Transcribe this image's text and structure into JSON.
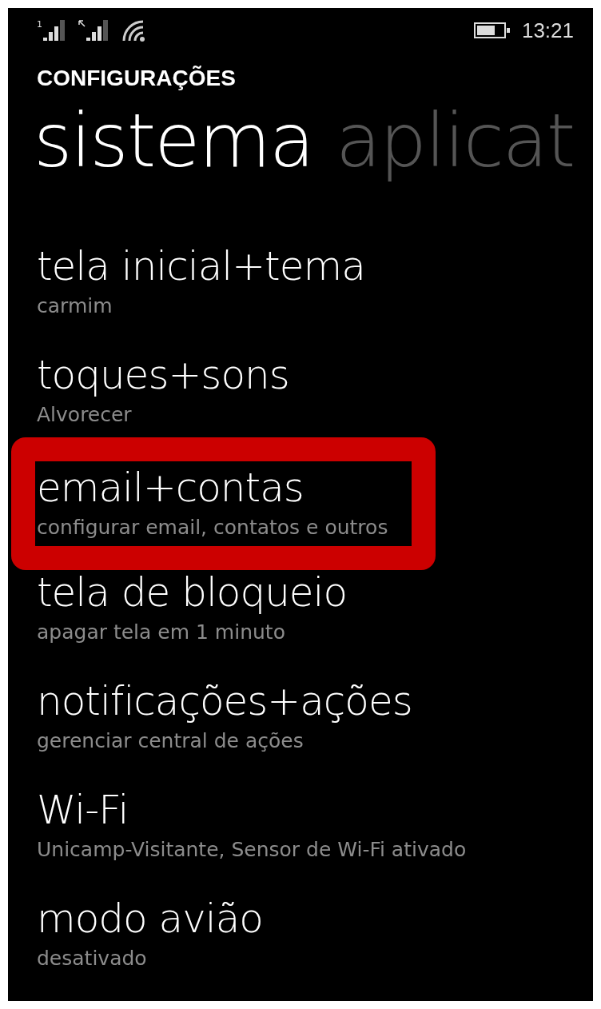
{
  "status_bar": {
    "sim_1_label": "1",
    "time": "13:21"
  },
  "header": {
    "title": "CONFIGURAÇÕES"
  },
  "pivot": [
    {
      "label": "sistema",
      "selected": true
    },
    {
      "label": "aplicat",
      "selected": false
    }
  ],
  "items": [
    {
      "title": "tela inicial+tema",
      "subtitle": "carmim",
      "highlighted": false
    },
    {
      "title": "toques+sons",
      "subtitle": "Alvorecer",
      "highlighted": false
    },
    {
      "title": "email+contas",
      "subtitle": "configurar email, contatos e outros",
      "highlighted": true
    },
    {
      "title": "tela de bloqueio",
      "subtitle": "apagar tela em 1 minuto",
      "highlighted": false
    },
    {
      "title": "notificações+ações",
      "subtitle": "gerenciar central de ações",
      "highlighted": false
    },
    {
      "title": "Wi-Fi",
      "subtitle": "Unicamp-Visitante, Sensor de Wi-Fi ativado",
      "highlighted": false
    },
    {
      "title": "modo avião",
      "subtitle": "desativado",
      "highlighted": false
    }
  ]
}
